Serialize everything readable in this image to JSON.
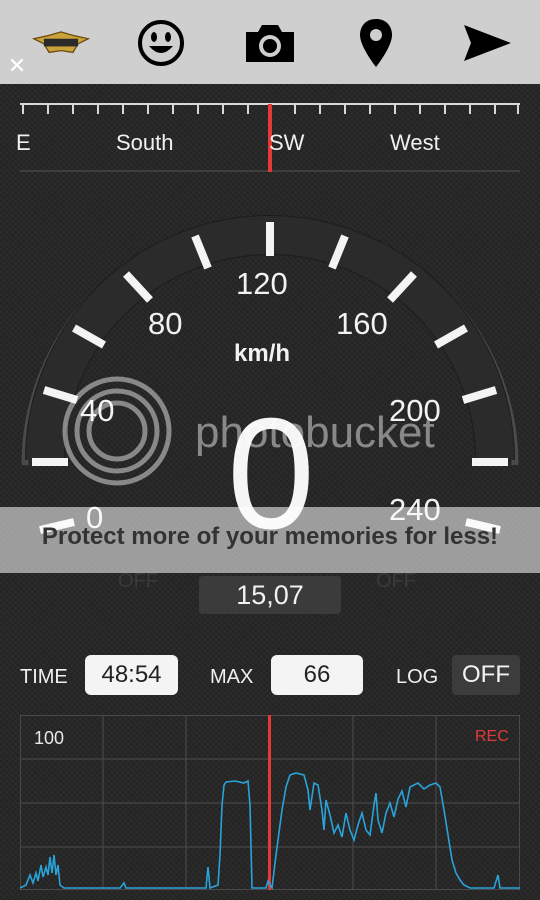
{
  "toolbar": {
    "icons": [
      "logo-badge",
      "smiley-icon",
      "camera-icon",
      "location-pin-icon",
      "send-icon"
    ],
    "close": "✕"
  },
  "compass": {
    "labels": [
      "E",
      "South",
      "SW",
      "West"
    ],
    "needle_color": "#e53935"
  },
  "speedometer": {
    "unit": "km/h",
    "speed": "0",
    "scale_labels": [
      "0",
      "40",
      "80",
      "120",
      "160",
      "200",
      "240"
    ],
    "off_left": "OFF",
    "off_right": "OFF",
    "trip": "15,07"
  },
  "watermark": {
    "logo": "photobucket",
    "text": "Protect more of your memories for less!"
  },
  "stats": {
    "time_label": "TIME",
    "time_value": "48:54",
    "max_label": "MAX",
    "max_value": "66",
    "log_label": "LOG",
    "log_value": "OFF"
  },
  "graph": {
    "max_label": "100",
    "rec_label": "REC",
    "line_color": "#29a3d9"
  }
}
